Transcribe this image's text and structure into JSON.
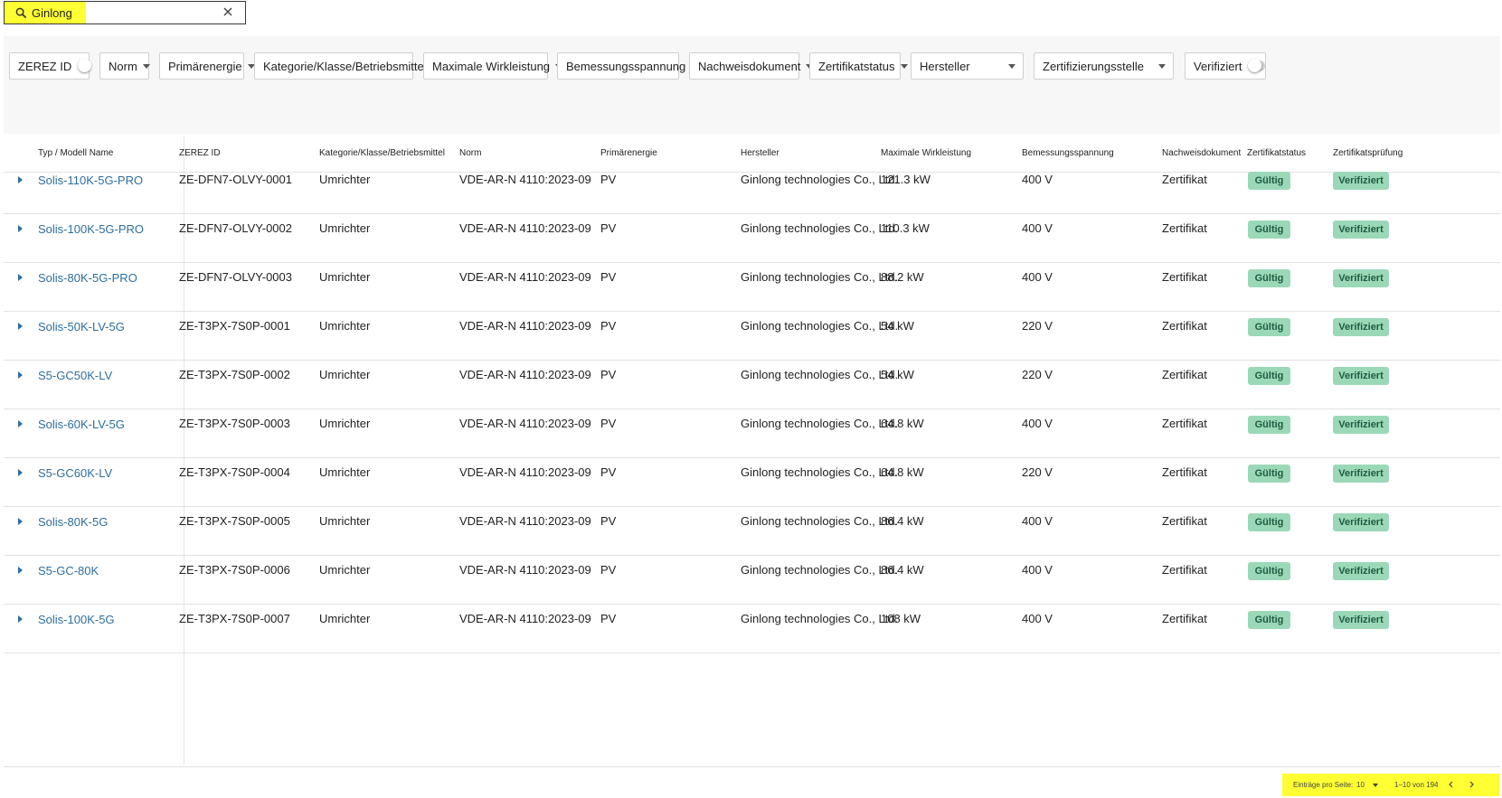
{
  "search": {
    "value": "Ginlong",
    "search_icon": "search-icon",
    "clear_icon": "close-icon"
  },
  "filters": [
    {
      "label": "ZEREZ ID",
      "kind": "toggle"
    },
    {
      "label": "Norm",
      "kind": "dropdown"
    },
    {
      "label": "Primärenergie",
      "kind": "dropdown"
    },
    {
      "label": "Kategorie/Klasse/Betriebsmittel",
      "kind": "dropdown"
    },
    {
      "label": "Maximale Wirkleistung",
      "kind": "dropdown"
    },
    {
      "label": "Bemessungsspannung",
      "kind": "dropdown"
    },
    {
      "label": "Nachweisdokument",
      "kind": "dropdown"
    },
    {
      "label": "Zertifikatstatus",
      "kind": "dropdown"
    },
    {
      "label": "Hersteller",
      "kind": "select"
    },
    {
      "label": "Zertifizierungsstelle",
      "kind": "select"
    },
    {
      "label": "Verifiziert",
      "kind": "toggle"
    }
  ],
  "table": {
    "columns": [
      "Typ / Modell Name",
      "ZEREZ ID",
      "Kategorie/Klasse/Betriebsmittel",
      "Norm",
      "Primärenergie",
      "Hersteller",
      "Maximale Wirkleistung",
      "Bemessungsspannung",
      "Nachweisdokument",
      "Zertifikatstatus",
      "Zertifikatsprüfung"
    ],
    "rows": [
      {
        "model": "Solis-110K-5G-PRO",
        "zerez_id": "ZE-DFN7-OLVY-0001",
        "category": "Umrichter",
        "norm": "VDE-AR-N 4110:2023-09",
        "energy": "PV",
        "manufacturer": "Ginlong technologies Co., Ltd.",
        "power": "121.3 kW",
        "voltage": "400 V",
        "document": "Zertifikat",
        "status": "Gültig",
        "check": "Verifiziert"
      },
      {
        "model": "Solis-100K-5G-PRO",
        "zerez_id": "ZE-DFN7-OLVY-0002",
        "category": "Umrichter",
        "norm": "VDE-AR-N 4110:2023-09",
        "energy": "PV",
        "manufacturer": "Ginlong technologies Co., Ltd.",
        "power": "110.3 kW",
        "voltage": "400 V",
        "document": "Zertifikat",
        "status": "Gültig",
        "check": "Verifiziert"
      },
      {
        "model": "Solis-80K-5G-PRO",
        "zerez_id": "ZE-DFN7-OLVY-0003",
        "category": "Umrichter",
        "norm": "VDE-AR-N 4110:2023-09",
        "energy": "PV",
        "manufacturer": "Ginlong technologies Co., Ltd.",
        "power": "88.2 kW",
        "voltage": "400 V",
        "document": "Zertifikat",
        "status": "Gültig",
        "check": "Verifiziert"
      },
      {
        "model": "Solis-50K-LV-5G",
        "zerez_id": "ZE-T3PX-7S0P-0001",
        "category": "Umrichter",
        "norm": "VDE-AR-N 4110:2023-09",
        "energy": "PV",
        "manufacturer": "Ginlong technologies Co., Ltd.",
        "power": "54 kW",
        "voltage": "220 V",
        "document": "Zertifikat",
        "status": "Gültig",
        "check": "Verifiziert"
      },
      {
        "model": "S5-GC50K-LV",
        "zerez_id": "ZE-T3PX-7S0P-0002",
        "category": "Umrichter",
        "norm": "VDE-AR-N 4110:2023-09",
        "energy": "PV",
        "manufacturer": "Ginlong technologies Co., Ltd.",
        "power": "54 kW",
        "voltage": "220 V",
        "document": "Zertifikat",
        "status": "Gültig",
        "check": "Verifiziert"
      },
      {
        "model": "Solis-60K-LV-5G",
        "zerez_id": "ZE-T3PX-7S0P-0003",
        "category": "Umrichter",
        "norm": "VDE-AR-N 4110:2023-09",
        "energy": "PV",
        "manufacturer": "Ginlong technologies Co., Ltd.",
        "power": "64.8 kW",
        "voltage": "400 V",
        "document": "Zertifikat",
        "status": "Gültig",
        "check": "Verifiziert"
      },
      {
        "model": "S5-GC60K-LV",
        "zerez_id": "ZE-T3PX-7S0P-0004",
        "category": "Umrichter",
        "norm": "VDE-AR-N 4110:2023-09",
        "energy": "PV",
        "manufacturer": "Ginlong technologies Co., Ltd.",
        "power": "64.8 kW",
        "voltage": "220 V",
        "document": "Zertifikat",
        "status": "Gültig",
        "check": "Verifiziert"
      },
      {
        "model": "Solis-80K-5G",
        "zerez_id": "ZE-T3PX-7S0P-0005",
        "category": "Umrichter",
        "norm": "VDE-AR-N 4110:2023-09",
        "energy": "PV",
        "manufacturer": "Ginlong technologies Co., Ltd.",
        "power": "86.4 kW",
        "voltage": "400 V",
        "document": "Zertifikat",
        "status": "Gültig",
        "check": "Verifiziert"
      },
      {
        "model": "S5-GC-80K",
        "zerez_id": "ZE-T3PX-7S0P-0006",
        "category": "Umrichter",
        "norm": "VDE-AR-N 4110:2023-09",
        "energy": "PV",
        "manufacturer": "Ginlong technologies Co., Ltd.",
        "power": "86.4 kW",
        "voltage": "400 V",
        "document": "Zertifikat",
        "status": "Gültig",
        "check": "Verifiziert"
      },
      {
        "model": "Solis-100K-5G",
        "zerez_id": "ZE-T3PX-7S0P-0007",
        "category": "Umrichter",
        "norm": "VDE-AR-N 4110:2023-09",
        "energy": "PV",
        "manufacturer": "Ginlong technologies Co., Ltd.",
        "power": "108 kW",
        "voltage": "400 V",
        "document": "Zertifikat",
        "status": "Gültig",
        "check": "Verifiziert"
      }
    ]
  },
  "pagination": {
    "per_page_label": "Einträge pro Seite:",
    "per_page_value": "10",
    "range": "1–10 von 194",
    "prev_icon": "chevron-left-icon",
    "next_icon": "chevron-right-icon"
  },
  "colors": {
    "highlight": "#ffff33",
    "link": "#2e6e9e",
    "badge_bg": "#9bd8b8",
    "badge_text": "#1f5c43"
  }
}
